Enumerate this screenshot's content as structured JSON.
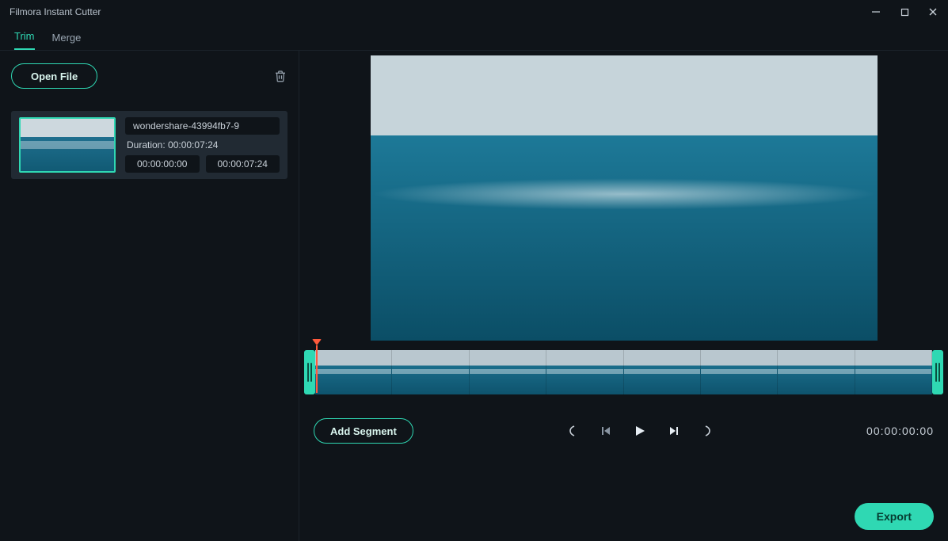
{
  "window": {
    "title": "Filmora Instant Cutter"
  },
  "tabs": {
    "trim": "Trim",
    "merge": "Merge",
    "active": "trim"
  },
  "sidebar": {
    "open_file": "Open File",
    "clip": {
      "filename": "wondershare-43994fb7-9",
      "duration_label": "Duration: 00:00:07:24",
      "in": "00:00:00:00",
      "out": "00:00:07:24"
    }
  },
  "controls": {
    "add_segment": "Add Segment",
    "timecode": "00:00:00:00"
  },
  "footer": {
    "export": "Export"
  },
  "timeline": {
    "frame_count": 8
  },
  "colors": {
    "accent": "#2fd8b3",
    "bg": "#0f1419",
    "panel": "#212a33"
  }
}
